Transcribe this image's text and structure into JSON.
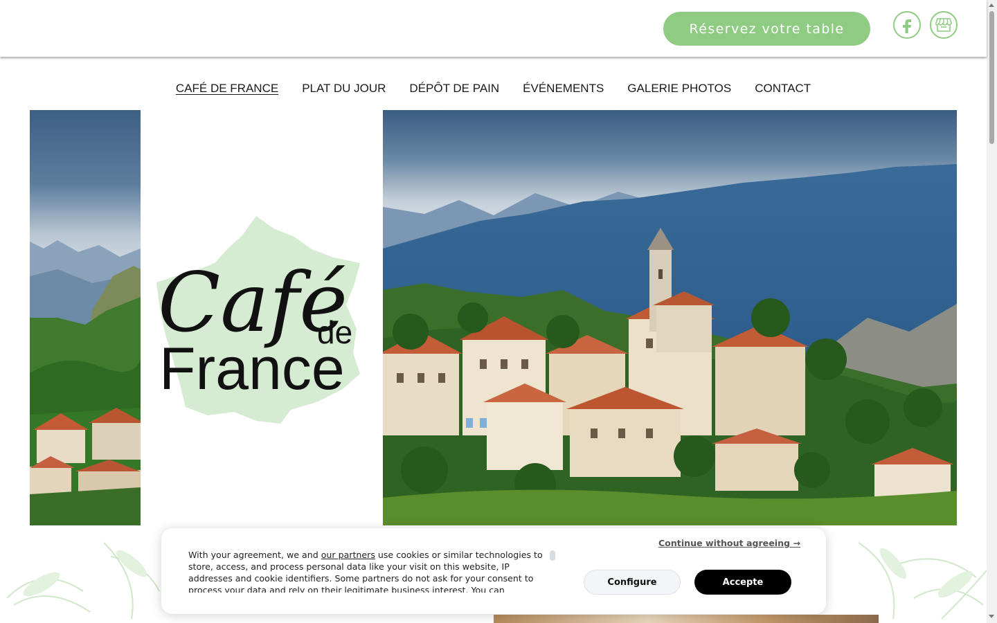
{
  "header": {
    "reserve_label": "Réservez votre table",
    "social": [
      {
        "icon": "facebook-icon"
      },
      {
        "icon": "storefront-icon"
      }
    ],
    "accent_color": "#8fcb82"
  },
  "nav": {
    "items": [
      {
        "label": "CAFÉ DE FRANCE",
        "active": true
      },
      {
        "label": "PLAT DU JOUR"
      },
      {
        "label": "DÉPÔT DE PAIN"
      },
      {
        "label": "ÉVÉNEMENTS"
      },
      {
        "label": "GALERIE PHOTOS"
      },
      {
        "label": "CONTACT"
      }
    ]
  },
  "logo": {
    "line1": "Café",
    "line2": "de",
    "line3": "France"
  },
  "cookie": {
    "text_before_link": "With your agreement, we and ",
    "link_label": "our partners",
    "text_after_link": " use cookies or similar technologies to store, access, and process personal data like your visit on this website, IP addresses and cookie identifiers. Some partners do not ask for your consent to process your data and rely on their legitimate business interest. You can",
    "continue_label": "Continue without agreeing →",
    "configure_label": "Configure",
    "accept_label": "Accepte"
  }
}
